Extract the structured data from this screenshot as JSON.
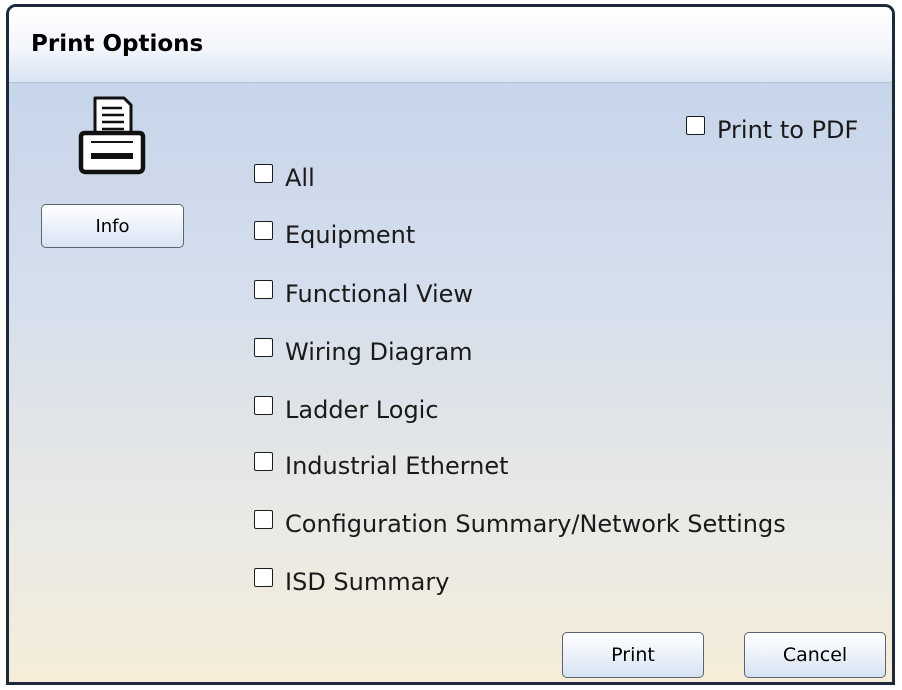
{
  "dialog": {
    "title": "Print Options"
  },
  "buttons": {
    "info": "Info",
    "print": "Print",
    "cancel": "Cancel"
  },
  "print_to_pdf": {
    "label": "Print to PDF",
    "checked": false
  },
  "options": [
    {
      "label": "All",
      "checked": false
    },
    {
      "label": "Equipment",
      "checked": false
    },
    {
      "label": "Functional View",
      "checked": false
    },
    {
      "label": "Wiring Diagram",
      "checked": false
    },
    {
      "label": "Ladder Logic",
      "checked": false
    },
    {
      "label": "Industrial Ethernet",
      "checked": false
    },
    {
      "label": "Configuration Summary/Network Settings",
      "checked": false
    },
    {
      "label": "ISD Summary",
      "checked": false
    }
  ],
  "icons": {
    "printer": "printer-icon"
  },
  "colors": {
    "frame": "#1e2a3c",
    "button_border": "#5b6472"
  }
}
